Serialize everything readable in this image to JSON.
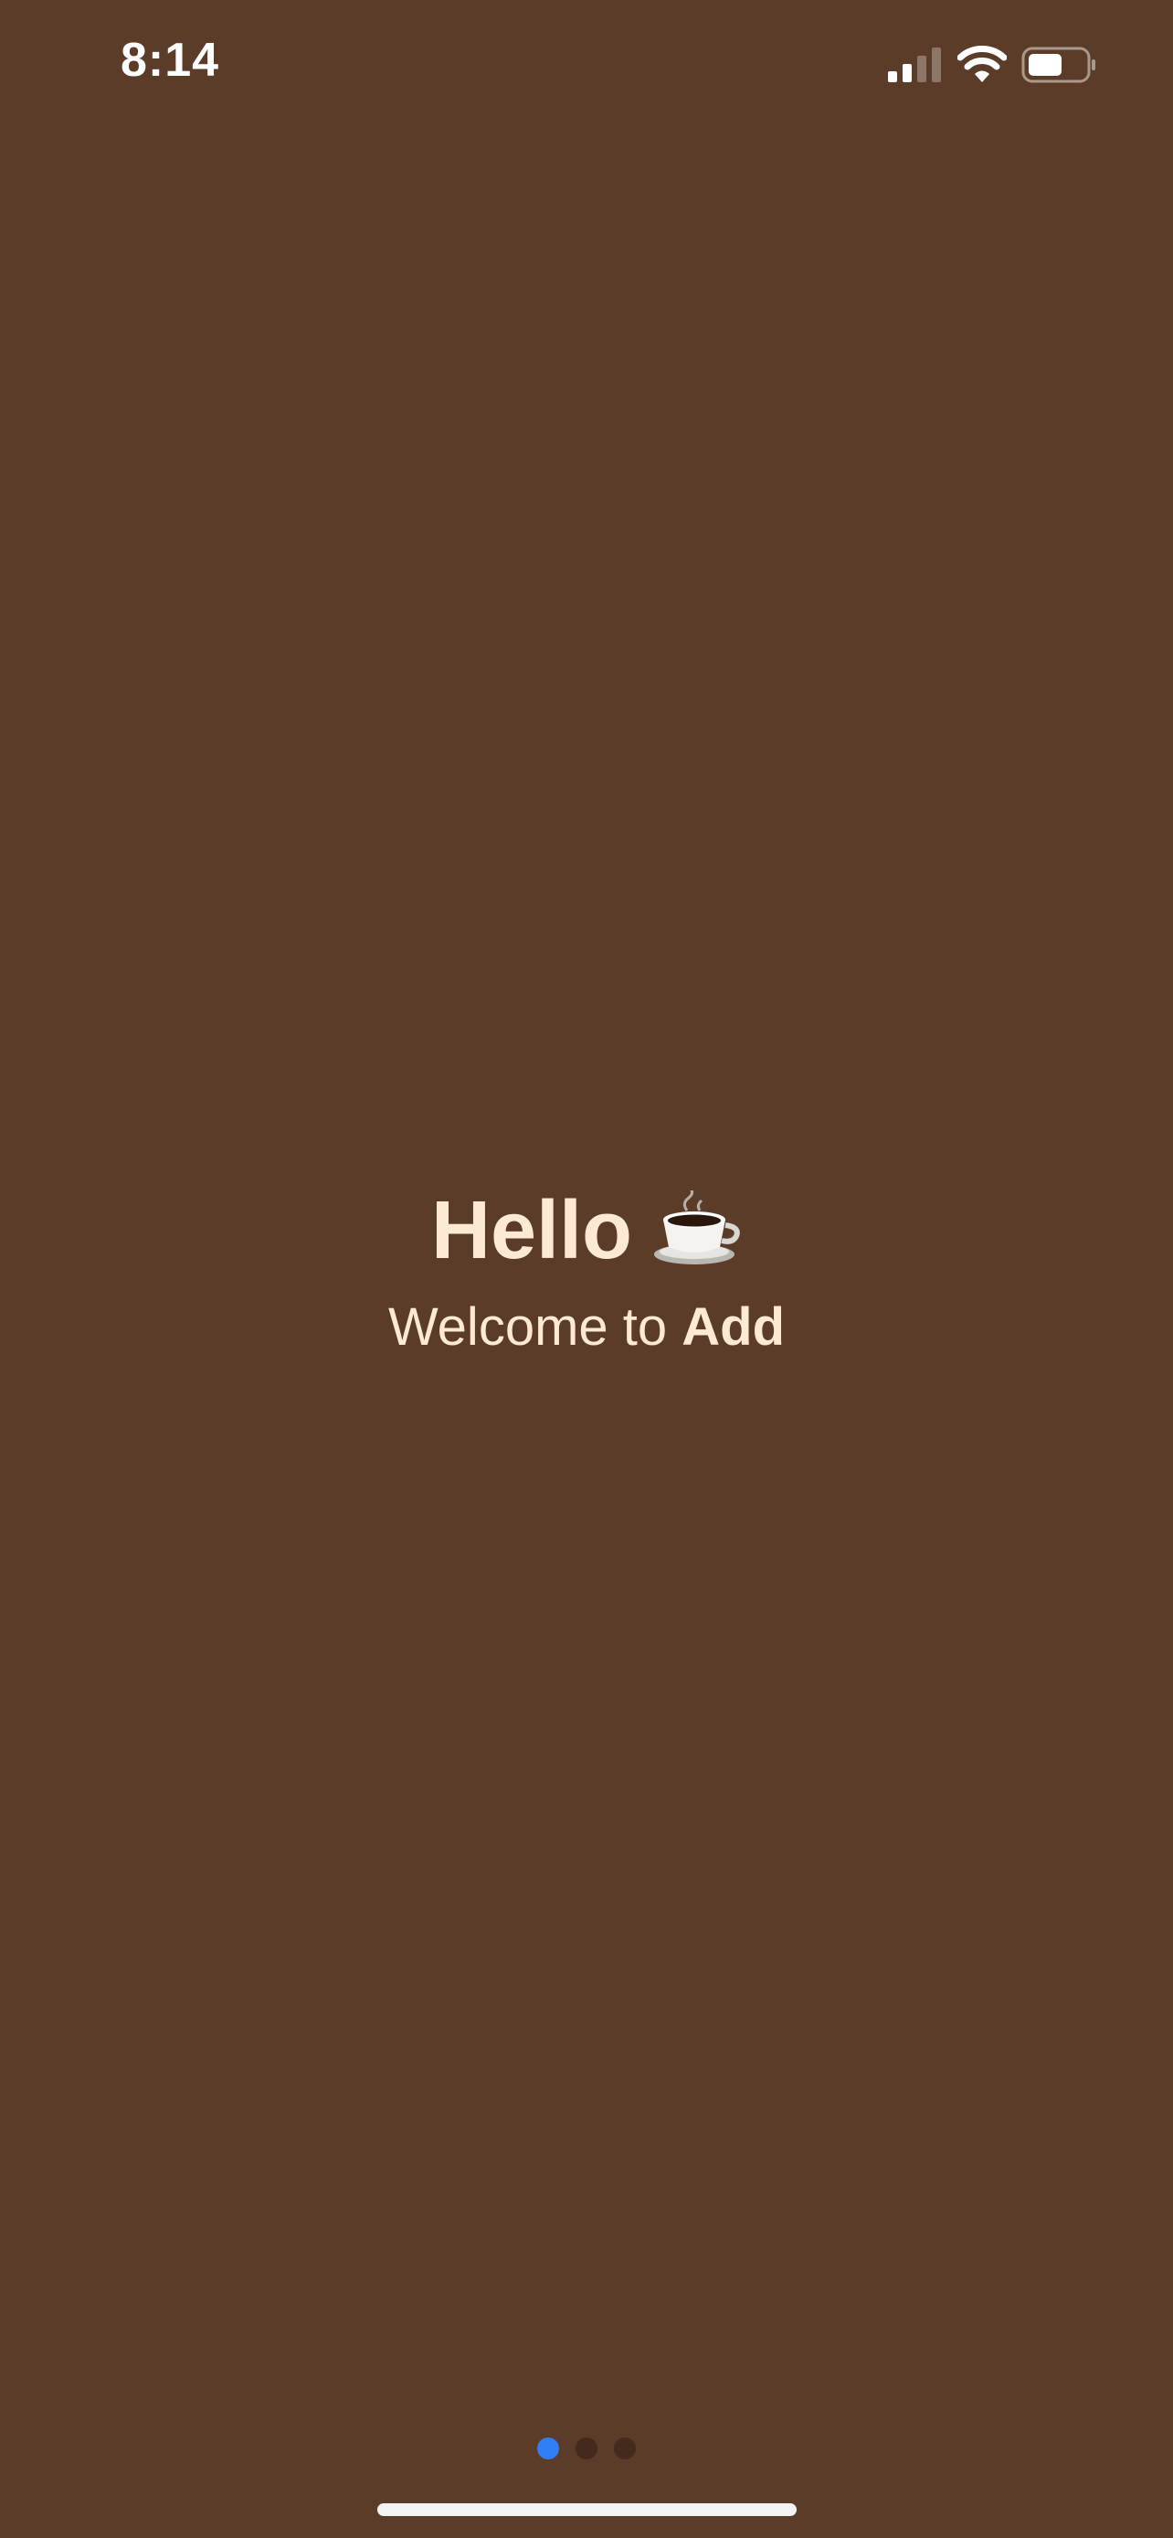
{
  "status_bar": {
    "time": "8:14",
    "icons": [
      "signal-icon",
      "wifi-icon",
      "battery-icon"
    ]
  },
  "welcome": {
    "greeting": "Hello",
    "greeting_emoji": "coffee-cup-icon",
    "subtitle_prefix": "Welcome to ",
    "app_name": "Add"
  },
  "pager": {
    "pages": 3,
    "active_index": 0,
    "active_color": "#2f7ff7",
    "inactive_color": "#432a1c"
  },
  "colors": {
    "background": "#5b3c29",
    "text": "#fde9d4"
  }
}
